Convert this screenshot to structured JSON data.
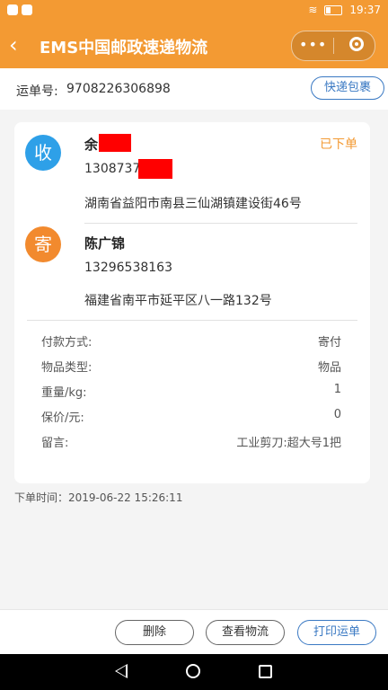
{
  "status_bar": {
    "time": "19:37"
  },
  "title_bar": {
    "back_glyph": "‹",
    "title": "EMS中国邮政速递物流",
    "more_glyph": "•••"
  },
  "waybill": {
    "label": "运单号:",
    "number": "9708226306898",
    "package_button": "快递包裹"
  },
  "receiver": {
    "badge": "收",
    "name": "余",
    "phone": "1308737",
    "address": "湖南省益阳市南县三仙湖镇建设街46号"
  },
  "sender": {
    "badge": "寄",
    "name": "陈广锦",
    "phone": "13296538163",
    "address": "福建省南平市延平区八一路132号"
  },
  "order_status": "已下单",
  "details": [
    {
      "key": "付款方式:",
      "value": "寄付"
    },
    {
      "key": "物品类型:",
      "value": "物品"
    },
    {
      "key": "重量/kg:",
      "value": "1"
    },
    {
      "key": "保价/元:",
      "value": "0"
    },
    {
      "key": "留言:",
      "value": "工业剪刀:超大号1把"
    }
  ],
  "order_time": "下单时间：2019-06-22 15:26:11",
  "footer": {
    "delete": "删除",
    "track": "查看物流",
    "print": "打印运单"
  },
  "colors": {
    "brand": "#f39a33",
    "accent_blue": "#3a79c3",
    "receiver_badge": "#2ea0e8",
    "sender_badge": "#f28a2e"
  }
}
